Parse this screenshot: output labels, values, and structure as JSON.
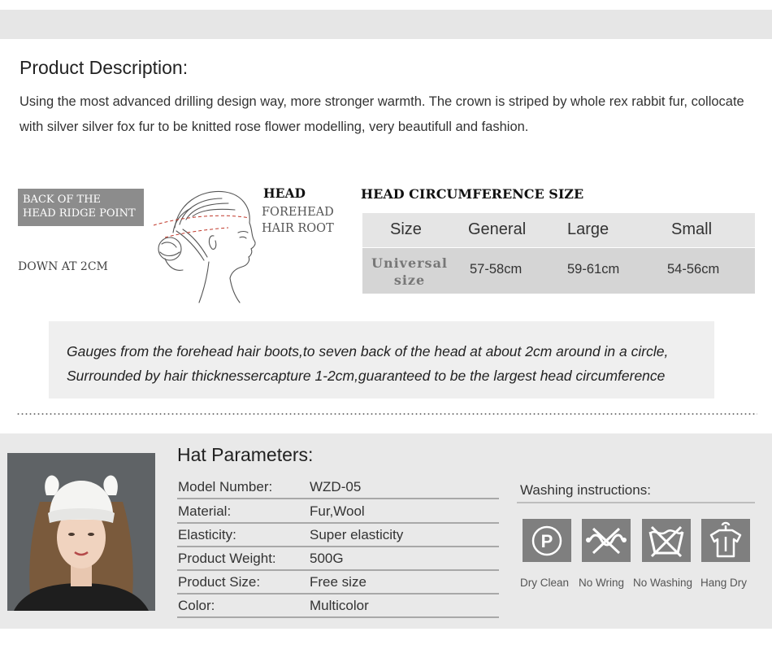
{
  "description": {
    "title": "Product Description:",
    "text": "Using the most advanced drilling design way, more stronger warmth. The crown is striped by whole rex rabbit fur, collocate with silver silver fox fur to be knitted rose flower modelling, very beautifull and fashion."
  },
  "diagram": {
    "back_line1": "BACK OF THE",
    "back_line2": "HEAD RIDGE POINT",
    "down": "DOWN AT 2CM",
    "head": "HEAD",
    "forehead_line1": "FOREHEAD",
    "forehead_line2": "HAIR ROOT"
  },
  "size_table": {
    "title": "HEAD CIRCUMFERENCE SIZE",
    "headers": [
      "Size",
      "General",
      "Large",
      "Small"
    ],
    "row_label_line1": "Universal",
    "row_label_line2": "size",
    "values": [
      "57-58cm",
      "59-61cm",
      "54-56cm"
    ]
  },
  "gauge": {
    "line1": "Gauges from the forehead hair boots,to seven back of the head at about 2cm around in a circle,",
    "line2": "Surrounded by hair thicknessercapture 1-2cm,guaranteed to be the largest head circumference"
  },
  "parameters": {
    "title": "Hat Parameters:",
    "rows": [
      {
        "key": "Model Number:",
        "value": "WZD-05"
      },
      {
        "key": "Material:",
        "value": "Fur,Wool"
      },
      {
        "key": "Elasticity:",
        "value": "Super elasticity"
      },
      {
        "key": "Product Weight:",
        "value": "500G"
      },
      {
        "key": "Product Size:",
        "value": "Free size"
      },
      {
        "key": "Color:",
        "value": "Multicolor"
      }
    ]
  },
  "washing": {
    "title": "Washing instructions:",
    "icons": [
      {
        "icon": "dry-clean-icon",
        "glyph": "P",
        "label": "Dry Clean"
      },
      {
        "icon": "no-wring-icon",
        "label": "No Wring"
      },
      {
        "icon": "no-washing-icon",
        "label": "No Washing"
      },
      {
        "icon": "hang-dry-icon",
        "label": "Hang Dry"
      }
    ]
  }
}
